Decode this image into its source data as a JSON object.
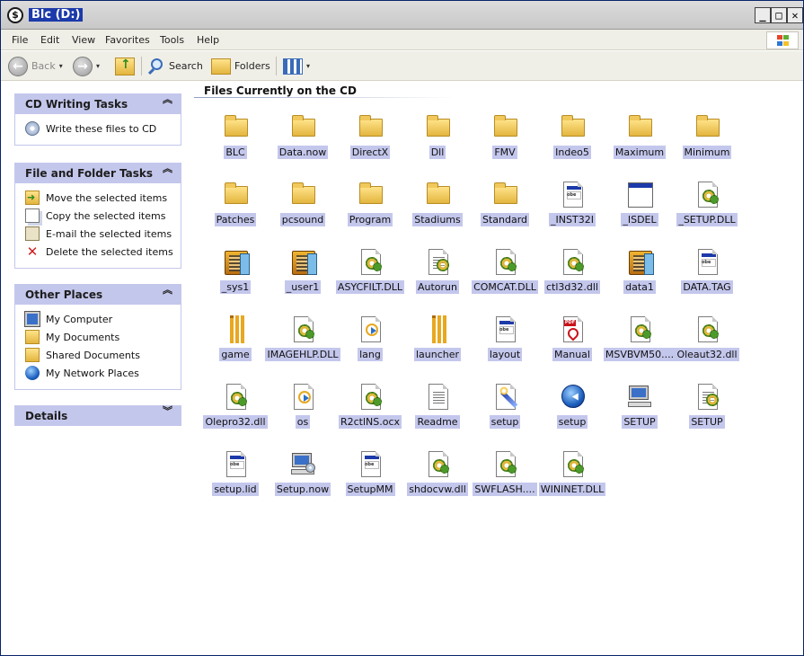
{
  "window": {
    "title": "Blc (D:)",
    "app_icon_glyph": "$",
    "controls": [
      "_",
      "□",
      "✕"
    ]
  },
  "menu": [
    "File",
    "Edit",
    "View",
    "Favorites",
    "Tools",
    "Help"
  ],
  "toolbar": {
    "back_label": "Back",
    "search_label": "Search",
    "folders_label": "Folders",
    "dropdown_glyph": "▾"
  },
  "panes": {
    "cd_writing": {
      "title": "CD Writing Tasks",
      "chevron": "⌃",
      "items": [
        {
          "label": "Write these files to CD",
          "icon": "cd-write-icon"
        }
      ]
    },
    "file_folder": {
      "title": "File and Folder Tasks",
      "chevron": "⌃",
      "items": [
        {
          "label": "Move the selected items",
          "icon": "move-icon"
        },
        {
          "label": "Copy the selected items",
          "icon": "copy-icon"
        },
        {
          "label": "E-mail the selected items",
          "icon": "email-icon"
        },
        {
          "label": "Delete the selected items",
          "icon": "delete-icon"
        }
      ]
    },
    "other_places": {
      "title": "Other Places",
      "chevron": "⌃",
      "items": [
        {
          "label": "My Computer",
          "icon": "my-computer-icon"
        },
        {
          "label": "My Documents",
          "icon": "my-documents-icon"
        },
        {
          "label": "Shared Documents",
          "icon": "shared-documents-icon"
        },
        {
          "label": "My Network Places",
          "icon": "network-places-icon"
        }
      ]
    },
    "details": {
      "title": "Details",
      "chevron": "⌄"
    }
  },
  "content": {
    "section_title": "Files Currently on the CD",
    "files": [
      {
        "name": "BLC",
        "icon": "folder"
      },
      {
        "name": "Data.now",
        "icon": "folder"
      },
      {
        "name": "DirectX",
        "icon": "folder"
      },
      {
        "name": "Dll",
        "icon": "folder"
      },
      {
        "name": "FMV",
        "icon": "folder"
      },
      {
        "name": "Indeo5",
        "icon": "folder"
      },
      {
        "name": "Maximum",
        "icon": "folder"
      },
      {
        "name": "Minimum",
        "icon": "folder"
      },
      {
        "name": "Patches",
        "icon": "folder"
      },
      {
        "name": "pcsound",
        "icon": "folder"
      },
      {
        "name": "Program",
        "icon": "folder"
      },
      {
        "name": "Stadiums",
        "icon": "folder"
      },
      {
        "name": "Standard",
        "icon": "folder"
      },
      {
        "name": "_INST32I",
        "icon": "exe"
      },
      {
        "name": "_ISDEL",
        "icon": "window"
      },
      {
        "name": "_SETUP.DLL",
        "icon": "dll"
      },
      {
        "name": "_sys1",
        "icon": "zip"
      },
      {
        "name": "_user1",
        "icon": "zip"
      },
      {
        "name": "ASYCFILT.DLL",
        "icon": "dll"
      },
      {
        "name": "Autorun",
        "icon": "settings"
      },
      {
        "name": "COMCAT.DLL",
        "icon": "dll"
      },
      {
        "name": "ctl3d32.dll",
        "icon": "dll"
      },
      {
        "name": "data1",
        "icon": "zip"
      },
      {
        "name": "DATA.TAG",
        "icon": "exe"
      },
      {
        "name": "game",
        "icon": "cricket"
      },
      {
        "name": "IMAGEHLP.DLL",
        "icon": "dll"
      },
      {
        "name": "lang",
        "icon": "media"
      },
      {
        "name": "launcher",
        "icon": "cricket"
      },
      {
        "name": "layout",
        "icon": "exe"
      },
      {
        "name": "Manual",
        "icon": "pdf"
      },
      {
        "name": "MSVBVM50....",
        "icon": "dll"
      },
      {
        "name": "Oleaut32.dll",
        "icon": "dll"
      },
      {
        "name": "Olepro32.dll",
        "icon": "dll"
      },
      {
        "name": "os",
        "icon": "media"
      },
      {
        "name": "R2ctlNS.ocx",
        "icon": "dll"
      },
      {
        "name": "Readme",
        "icon": "text"
      },
      {
        "name": "setup",
        "icon": "wand"
      },
      {
        "name": "setup",
        "icon": "globe"
      },
      {
        "name": "SETUP",
        "icon": "computer"
      },
      {
        "name": "SETUP",
        "icon": "settings"
      },
      {
        "name": "setup.lid",
        "icon": "exe"
      },
      {
        "name": "Setup.now",
        "icon": "computer-disk"
      },
      {
        "name": "SetupMM",
        "icon": "exe"
      },
      {
        "name": "shdocvw.dll",
        "icon": "dll"
      },
      {
        "name": "SWFLASH....",
        "icon": "dll"
      },
      {
        "name": "WININET.DLL",
        "icon": "dll"
      }
    ]
  },
  "colors": {
    "selection": "#c4c7ec",
    "pane_header": "#c4c7ec",
    "title_highlight": "#1c3aa9",
    "chrome": "#f0efe7"
  }
}
